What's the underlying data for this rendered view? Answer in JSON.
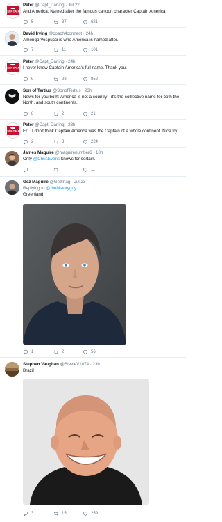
{
  "tweets": [
    {
      "name": "Peter",
      "handle": "@Capt_Darling",
      "time": "Jul 22",
      "text": "And America. Named after the famous cartoon character Captain America.",
      "avatar": "keep-calm",
      "replies": "5",
      "retweets": "37",
      "likes": "621"
    },
    {
      "name": "David Irving",
      "handle": "@coach4connect",
      "time": "24h",
      "text": "Amerigo Vespucci is who America is named after.",
      "avatar": "person",
      "replies": "7",
      "retweets": "11",
      "likes": "101"
    },
    {
      "name": "Peter",
      "handle": "@Capt_Darling",
      "time": "24h",
      "text": "I never knew Captain America's full name. Thank you.",
      "avatar": "keep-calm",
      "replies": "9",
      "retweets": "28",
      "likes": "852"
    },
    {
      "name": "Son of Tertius",
      "handle": "@SonofTertius",
      "time": "23h",
      "text": "News for you both: America is not a country - it's the colllective name for both the North, and south continents.",
      "avatar": "dark-logo",
      "replies": "8",
      "retweets": "2",
      "likes": "21"
    },
    {
      "name": "Peter",
      "handle": "@Capt_Darling",
      "time": "23h",
      "text": "Er... I don't think Captain America was the Captain of a whole continent. Nice try.",
      "avatar": "keep-calm",
      "replies": "2",
      "retweets": "3",
      "likes": "224"
    },
    {
      "name": "James Maguire",
      "handle": "@maguirenumber6",
      "time": "18h",
      "text_before": "Only ",
      "text_link": "@ChrisEvans",
      "text_after": " knows for certain.",
      "avatar": "person",
      "replies": "",
      "retweets": "",
      "likes": "11"
    },
    {
      "name": "Gez Maguire",
      "handle": "@Gezmag",
      "time": "Jul 23",
      "replying_prefix": "Replying to ",
      "replying_to": "@thehistoryguy",
      "text": "Greenland",
      "avatar": "person",
      "replies": "1",
      "retweets": "2",
      "likes": "56"
    },
    {
      "name": "Stephen Vaughan",
      "handle": "@StevieV1874",
      "time": "23h",
      "text": "Brazil",
      "avatar": "person",
      "replies": "3",
      "retweets": "15",
      "likes": "259"
    }
  ],
  "keep_calm_text": "KEEP CALM",
  "colors": {
    "link": "#1da1f2",
    "muted": "#657786",
    "keep_calm": "#c8102e"
  }
}
